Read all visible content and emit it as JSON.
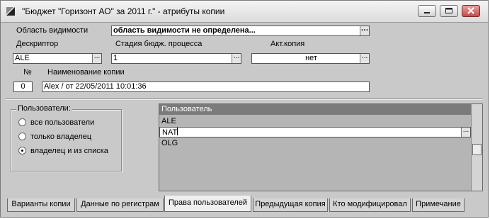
{
  "window": {
    "title": "\"Бюджет \"Горизонт АО\" за 2011 г.\" - атрибуты копии"
  },
  "form": {
    "visibility": {
      "label": "Область видимости",
      "value": "область видимости не определена..."
    },
    "descriptor": {
      "label": "Дескриптор",
      "value": "ALE"
    },
    "stage": {
      "label": "Стадия бюдж. процесса",
      "value": "1"
    },
    "active_copy": {
      "label": "Акт.копия",
      "value": "нет"
    },
    "number": {
      "label": "№",
      "value": "0"
    },
    "copy_name": {
      "label": "Наименование копии",
      "value": "Alex / от 22/05/2011 10:01:36"
    },
    "ellipsis": "..."
  },
  "users_group": {
    "legend": "Пользователи:",
    "options": [
      {
        "label": "все пользователи",
        "selected": false
      },
      {
        "label": "только владелец",
        "selected": false
      },
      {
        "label": "владелец и из списка",
        "selected": true
      }
    ]
  },
  "users_list": {
    "header": "Пользователь",
    "rows": [
      "ALE",
      "NAT",
      "OLG"
    ],
    "editing_row": 1
  },
  "tabs": [
    {
      "label": "Варианты копии",
      "active": false
    },
    {
      "label": "Данные по регистрам",
      "active": false
    },
    {
      "label": "Права пользователей",
      "active": true
    },
    {
      "label": "Предыдущая копия",
      "active": false
    },
    {
      "label": "Кто модифицировал",
      "active": false
    },
    {
      "label": "Примечание",
      "active": false
    }
  ]
}
